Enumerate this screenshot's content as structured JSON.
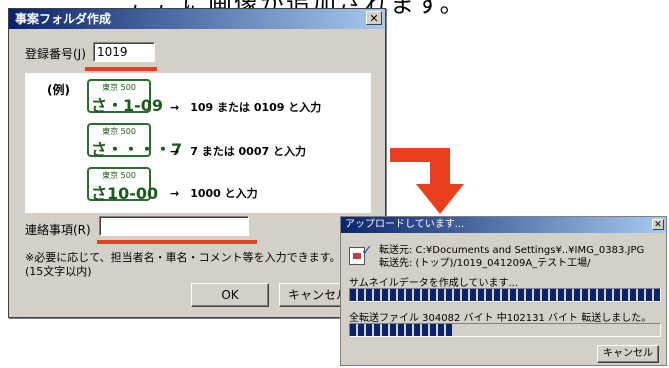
{
  "headline": "ここに画像が追加されます。",
  "dialog1": {
    "title": "事案フォルダ作成",
    "close_glyph": "✕",
    "reg_label": "登録番号(J)",
    "reg_value": "1019",
    "example_label": "(例)",
    "plates": [
      {
        "region": "東京 500",
        "number": "さ・1-09",
        "desc": "→　109 または 0109 と入力"
      },
      {
        "region": "東京 500",
        "number": "さ・・・・7",
        "desc": "→　7 または 0007 と入力"
      },
      {
        "region": "東京 500",
        "number": "さ10-00",
        "desc": "→　1000 と入力"
      }
    ],
    "contact_label": "連絡事項(R)",
    "contact_value": "",
    "note_line1": "※必要に応じて、担当者名・車名・コメント等を入力できます。",
    "note_line2": "(15文字以内)",
    "ok_label": "OK",
    "cancel_label": "キャンセル"
  },
  "dialog2": {
    "title": "アップロードしています...",
    "close_glyph": "✕",
    "source_line": "転送元:  C:¥Documents and Settings¥..¥IMG_0383.JPG",
    "dest_line": "転送先:  (トップ)/1019_041209A_テスト工場/",
    "thumb_status": "サムネイルデータを作成しています...",
    "thumb_progress": 1.0,
    "transfer_status": "全転送ファイル  304082 バイト 中102131 バイト 転送しました。",
    "transfer_progress": 0.336,
    "cancel_label": "キャンセル"
  },
  "colors": {
    "accent": "#e8401c",
    "titlebar": "#0a246a",
    "plate_green": "#2d6a2d"
  }
}
